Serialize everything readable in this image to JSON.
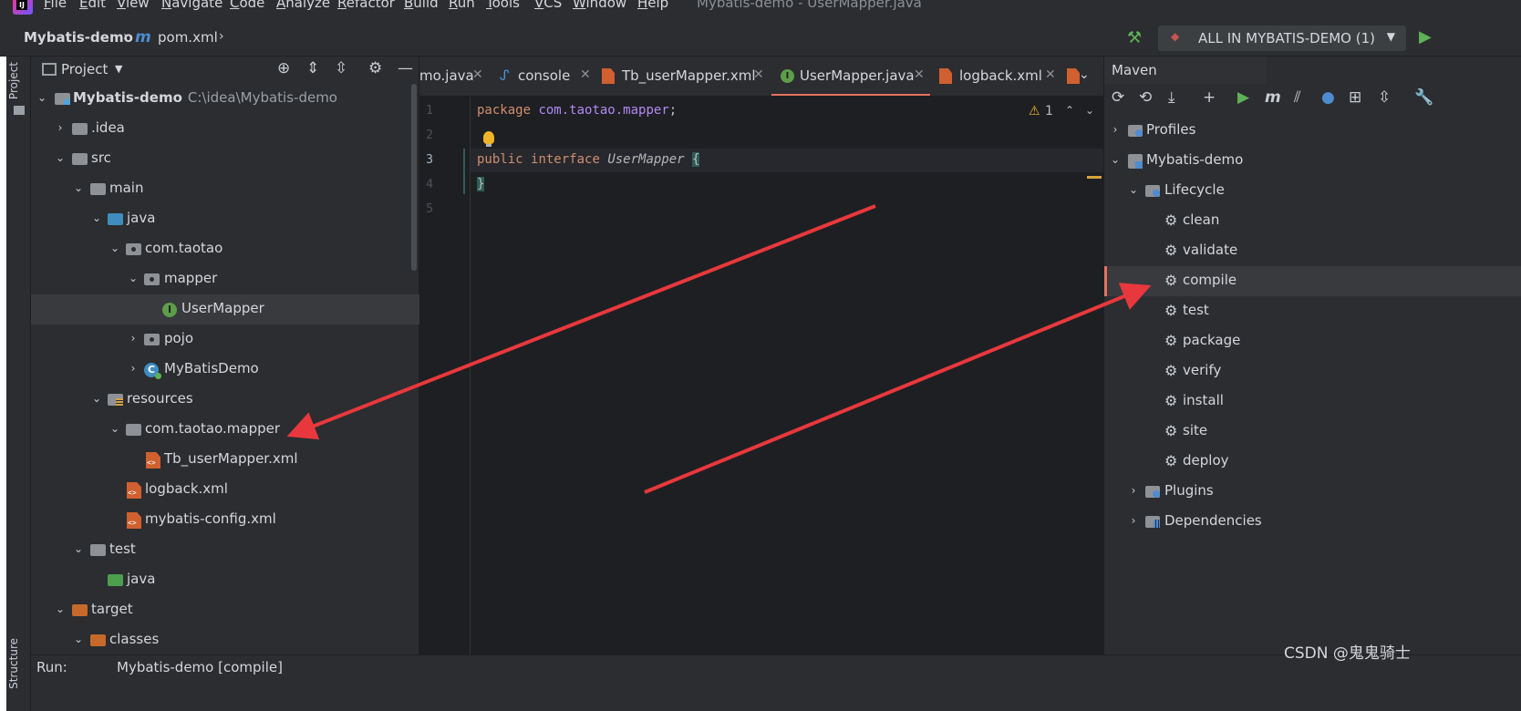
{
  "menu": {
    "items": [
      "File",
      "Edit",
      "View",
      "Navigate",
      "Code",
      "Analyze",
      "Refactor",
      "Build",
      "Run",
      "Tools",
      "VCS",
      "Window",
      "Help"
    ],
    "window_title": "Mybatis-demo - UserMapper.java"
  },
  "navbar": {
    "project": "Mybatis-demo",
    "file": "pom.xml",
    "run_config": "ALL IN MYBATIS-DEMO (1)"
  },
  "left_stripe": {
    "project_tab": "Project",
    "structure_tab": "Structure"
  },
  "project_panel": {
    "title": "Project",
    "tree": [
      {
        "label": "Mybatis-demo",
        "path": "C:\\idea\\Mybatis-demo"
      },
      {
        "label": ".idea"
      },
      {
        "label": "src"
      },
      {
        "label": "main"
      },
      {
        "label": "java"
      },
      {
        "label": "com.taotao"
      },
      {
        "label": "mapper"
      },
      {
        "label": "UserMapper"
      },
      {
        "label": "pojo"
      },
      {
        "label": "MyBatisDemo"
      },
      {
        "label": "resources"
      },
      {
        "label": "com.taotao.mapper"
      },
      {
        "label": "Tb_userMapper.xml"
      },
      {
        "label": "logback.xml"
      },
      {
        "label": "mybatis-config.xml"
      },
      {
        "label": "test"
      },
      {
        "label": "java"
      },
      {
        "label": "target"
      },
      {
        "label": "classes"
      }
    ]
  },
  "editor": {
    "tabs": [
      {
        "label": "mo.java"
      },
      {
        "label": "console"
      },
      {
        "label": "Tb_userMapper.xml"
      },
      {
        "label": "UserMapper.java"
      },
      {
        "label": "logback.xml"
      }
    ],
    "line_numbers": [
      "1",
      "2",
      "3",
      "4",
      "5"
    ],
    "code": {
      "l1_kw": "package",
      "l1_pkg": "com.taotao.mapper",
      "l1_semi": ";",
      "l3_kw1": "public",
      "l3_kw2": "interface",
      "l3_name": "UserMapper",
      "l3_brace": "{",
      "l4_brace": "}"
    },
    "warnings": {
      "icon": "warning-icon",
      "count": "1"
    }
  },
  "maven": {
    "title": "Maven",
    "profiles": "Profiles",
    "project": "Mybatis-demo",
    "lifecycle": "Lifecycle",
    "phases": [
      "clean",
      "validate",
      "compile",
      "test",
      "package",
      "verify",
      "install",
      "site",
      "deploy"
    ],
    "selected_phase": "compile",
    "plugins": "Plugins",
    "dependencies": "Dependencies"
  },
  "runbar": {
    "label": "Run:",
    "tab": "Mybatis-demo [compile]"
  },
  "watermark": "CSDN @鬼鬼骑士",
  "colors": {
    "accent": "#e5715d",
    "arrow": "#e8383d",
    "keyword": "#cf8e6d",
    "package": "#b189f5"
  }
}
